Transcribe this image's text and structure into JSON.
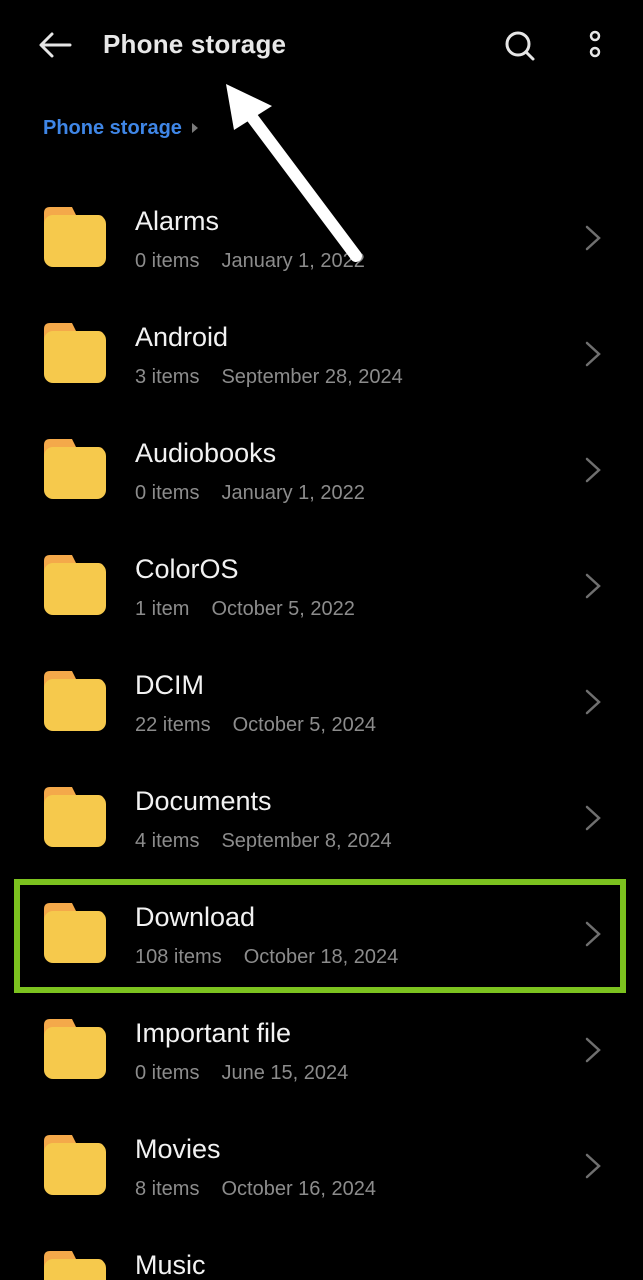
{
  "header": {
    "title": "Phone storage",
    "back_icon": "arrow-left-icon",
    "search_icon": "search-icon",
    "more_icon": "more-vertical-icon"
  },
  "breadcrumb": {
    "items": [
      "Phone storage"
    ]
  },
  "folders": [
    {
      "name": "Alarms",
      "count": "0 items",
      "date": "January 1, 2022"
    },
    {
      "name": "Android",
      "count": "3 items",
      "date": "September 28, 2024"
    },
    {
      "name": "Audiobooks",
      "count": "0 items",
      "date": "January 1, 2022"
    },
    {
      "name": "ColorOS",
      "count": "1 item",
      "date": "October 5, 2022"
    },
    {
      "name": "DCIM",
      "count": "22 items",
      "date": "October 5, 2024"
    },
    {
      "name": "Documents",
      "count": "4 items",
      "date": "September 8, 2024"
    },
    {
      "name": "Download",
      "count": "108 items",
      "date": "October 18, 2024"
    },
    {
      "name": "Important file",
      "count": "0 items",
      "date": "June 15, 2024"
    },
    {
      "name": "Movies",
      "count": "8 items",
      "date": "October 16, 2024"
    },
    {
      "name": "Music",
      "count": "",
      "date": ""
    }
  ],
  "colors": {
    "background": "#000000",
    "folder": "#f6c94c",
    "folder_tab": "#f4a94a",
    "accent": "#3f86e6",
    "highlight": "#7cc21f"
  }
}
